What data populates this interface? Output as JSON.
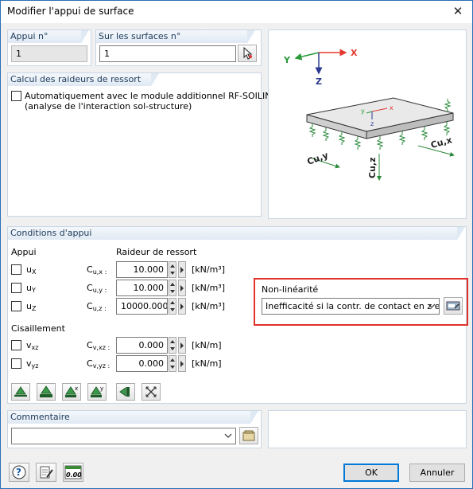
{
  "window": {
    "title": "Modifier l'appui de surface"
  },
  "support_no": {
    "label": "Appui n°",
    "value": "1"
  },
  "surfaces_no": {
    "label": "Sur les surfaces n°",
    "value": "1"
  },
  "spring_calc": {
    "header": "Calcul des raideurs de ressort",
    "auto_label_line1": "Automatiquement avec le module additionnel RF-SOILIN",
    "auto_label_line2": "(analyse de l'interaction sol-structure)"
  },
  "diagram": {
    "axis_x": "X",
    "axis_y": "Y",
    "axis_z": "Z",
    "plate_x": "x",
    "plate_y": "y",
    "plate_z": "z",
    "label_cuy": "Cu,y",
    "label_cux": "Cu,x",
    "label_cuz": "Cu,z",
    "colors": {
      "global_x": "#e23a2f",
      "global_y": "#2a9a3a",
      "global_z": "#2b3a8f",
      "spring": "#2a8a3a",
      "plate": "#e9e9e9"
    }
  },
  "conditions": {
    "header": "Conditions d'appui",
    "support_col": "Appui",
    "stiffness_col": "Raideur de ressort",
    "rows": [
      {
        "dof_main": "u",
        "dof_sub": "X",
        "coef_main": "C",
        "coef_sub": "u,x :",
        "value": "10.000",
        "unit": "[kN/m³]"
      },
      {
        "dof_main": "u",
        "dof_sub": "Y",
        "coef_main": "C",
        "coef_sub": "u,y :",
        "value": "10.000",
        "unit": "[kN/m³]"
      },
      {
        "dof_main": "u",
        "dof_sub": "Z",
        "coef_main": "C",
        "coef_sub": "u,z :",
        "value": "10000.000",
        "unit": "[kN/m³]"
      }
    ],
    "shear_label": "Cisaillement",
    "shear_rows": [
      {
        "dof_main": "v",
        "dof_sub": "xz",
        "coef_main": "C",
        "coef_sub": "v,xz :",
        "value": "0.000",
        "unit": "[kN/m]"
      },
      {
        "dof_main": "v",
        "dof_sub": "yz",
        "coef_main": "C",
        "coef_sub": "v,yz :",
        "value": "0.000",
        "unit": "[kN/m]"
      }
    ],
    "nonlinear": {
      "label": "Non-linéarité",
      "selected": "Inefficacité si la contr. de contact en z e"
    },
    "highlight_color": "#e0312b"
  },
  "toolbar_icons": [
    "support-hinged-icon",
    "support-fixed-icon",
    "support-fixed-x-icon",
    "support-fixed-y-icon",
    "support-edge-icon",
    "free-support-icon"
  ],
  "comment": {
    "header": "Commentaire",
    "value": ""
  },
  "footer": {
    "ok": "OK",
    "cancel": "Annuler",
    "units_icon_text": "0.00"
  }
}
